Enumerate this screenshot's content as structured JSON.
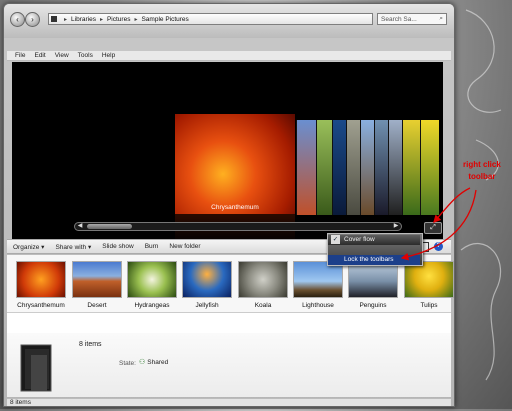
{
  "address": {
    "crumbs": [
      "Libraries",
      "Pictures",
      "Sample Pictures"
    ],
    "search_placeholder": "Search Sa..."
  },
  "menu": [
    "File",
    "Edit",
    "View",
    "Tools",
    "Help"
  ],
  "preview": {
    "caption": "Chrysanthemum"
  },
  "toolbar": {
    "organize": "Organize",
    "share": "Share with",
    "slideshow": "Slide show",
    "burn": "Burn",
    "newfolder": "New folder",
    "help": "?"
  },
  "context_menu": {
    "items": [
      "Cover flow",
      "",
      "Lock the toolbars"
    ]
  },
  "files": [
    {
      "name": "Chrysanthemum",
      "color": "#d94a10"
    },
    {
      "name": "Desert",
      "color": "#c45a2a"
    },
    {
      "name": "Hydrangeas",
      "color": "#8fae4a"
    },
    {
      "name": "Jellyfish",
      "color": "#1f5aa8"
    },
    {
      "name": "Koala",
      "color": "#8c8a80"
    },
    {
      "name": "Lighthouse",
      "color": "#6f9fd0"
    },
    {
      "name": "Penguins",
      "color": "#8fa8c0"
    },
    {
      "name": "Tulips",
      "color": "#e6c020"
    }
  ],
  "details": {
    "count": "8 items",
    "state_label": "State:",
    "state_value": "Shared"
  },
  "status": "8 items",
  "annotation": {
    "line1": "right click",
    "line2": "toolbar"
  },
  "colors": {
    "annotation": "#e00000",
    "context_highlight": "#1c3f8a"
  }
}
